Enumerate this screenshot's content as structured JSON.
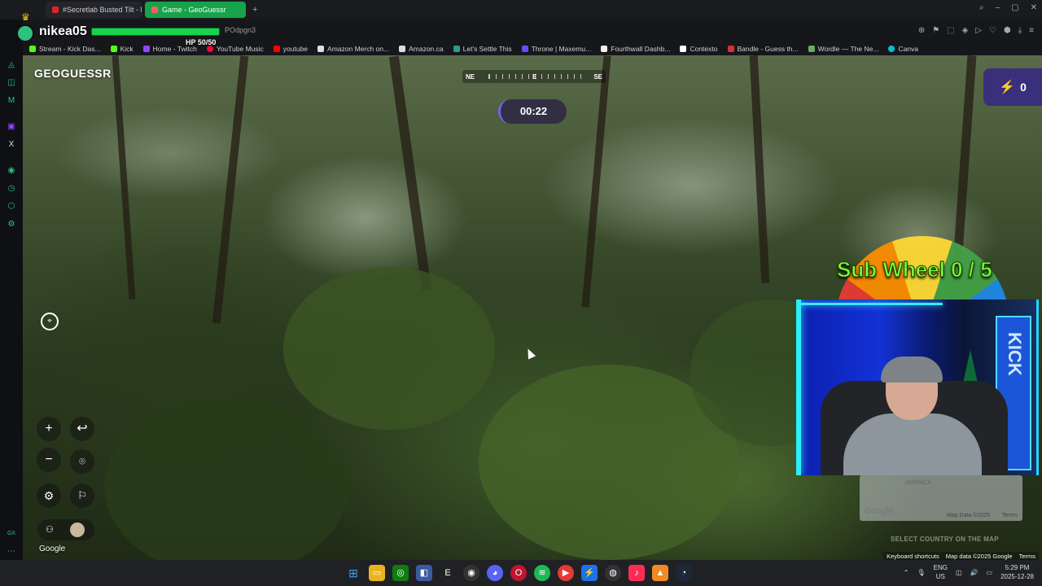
{
  "browser": {
    "tabs": [
      {
        "title": "#Secretlab Busted Tilt - Re",
        "active": false
      },
      {
        "title": "Game - GeoGuessr",
        "active": true
      }
    ],
    "new_tab": "+",
    "url": "POdpgn3",
    "bookmarks": [
      "Stream - Kick Das...",
      "Kick",
      "Home - Twitch",
      "YouTube Music",
      "youtube",
      "Amazon Merch on...",
      "Amazon.ca",
      "Let's Settle This",
      "Throne | Maxemu...",
      "Fourthwall Dashb...",
      "Contexto",
      "Bandle - Guess th...",
      "Wordle — The Ne...",
      "Canva"
    ],
    "sidebar_bottom_label": "GX"
  },
  "player": {
    "name": "nikea05",
    "hp_text": "HP 50/50",
    "hp_fraction": 1.0
  },
  "game": {
    "logo": "GEOGUESSR",
    "compass": {
      "left": "NE",
      "center": "E",
      "right": "SE"
    },
    "timer": "00:22",
    "score": "0",
    "google_mark": "Google",
    "minimap": {
      "region_label": "AMERICA",
      "google": "Google",
      "keyboard_shortcuts": "Keyboard shortcuts",
      "map_data": "Map Data ©2025",
      "terms": "Terms"
    },
    "select_country": "SELECT COUNTRY ON THE MAP",
    "footer": {
      "keyboard_shortcuts": "Keyboard shortcuts",
      "copyright": "Map data ©2025 Google",
      "terms": "Terms"
    }
  },
  "overlay": {
    "sub_wheel": "Sub Wheel 0 / 5",
    "kick_label": "KICK"
  },
  "taskbar": {
    "lang_top": "ENG",
    "lang_bottom": "US",
    "time": "5:29 PM",
    "date": "2025-12-28"
  },
  "colors": {
    "accent_green": "#17a34a",
    "score_bg": "#3a2f7a",
    "sub_wheel_text": "#7cff3a"
  }
}
